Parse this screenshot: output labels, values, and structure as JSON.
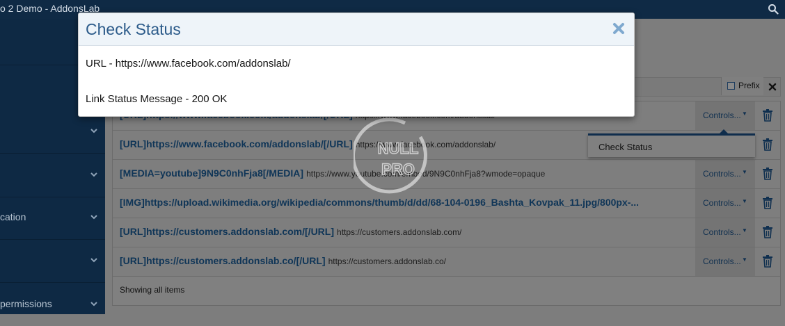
{
  "app": {
    "window_title": "o 2 Demo - AddonsLab"
  },
  "sidebar": {
    "items": [
      {
        "label": ""
      },
      {
        "label": ""
      },
      {
        "label": "cation"
      },
      {
        "label": ""
      },
      {
        "label": "permissions"
      }
    ]
  },
  "filter": {
    "prefix_label": "Prefix"
  },
  "list": {
    "rows": [
      {
        "bbcode": "[URL]https://www.facebook.com/addonslab/[/URL]",
        "url": "https://www.facebook.com/addonslab/",
        "controls": "Controls..."
      },
      {
        "bbcode": "[URL]https://www.facebook.com/addonslab/[/URL]",
        "url": "https://www.facebook.com/addonslab/",
        "controls": ""
      },
      {
        "bbcode": "[MEDIA=youtube]9N9C0nhFja8[/MEDIA]",
        "url": "https://www.youtube.com/embed/9N9C0nhFja8?wmode=opaque",
        "controls": "Controls..."
      },
      {
        "bbcode": "[IMG]https://upload.wikimedia.org/wikipedia/commons/thumb/d/dd/68-104-0196_Bashta_Kovpak_11.jpg/800px-...",
        "url": "",
        "controls": "Controls..."
      },
      {
        "bbcode": "[URL]https://customers.addonslab.com/[/URL]",
        "url": "https://customers.addonslab.com/",
        "controls": "Controls..."
      },
      {
        "bbcode": "[URL]https://customers.addonslab.co/[/URL]",
        "url": "https://customers.addonslab.co/",
        "controls": "Controls..."
      }
    ],
    "footer": "Showing all items"
  },
  "dropdown": {
    "item": "Check Status"
  },
  "watermark": {
    "line1": "NULL",
    "line2": "PRO"
  },
  "modal": {
    "title": "Check Status",
    "url_line": "URL - https://www.facebook.com/addonslab/",
    "status_line": "Link Status Message - 200 OK"
  },
  "colors": {
    "topbar": "#0f2a45",
    "sidebar": "#0e2944",
    "link": "#0f3557",
    "modal_title": "#2c5b8a",
    "overlay": "#7d7d7d"
  },
  "icons": [
    "search-icon",
    "chevron-down-icon",
    "checkbox-icon",
    "close-icon",
    "trash-icon",
    "caret-down-icon"
  ]
}
